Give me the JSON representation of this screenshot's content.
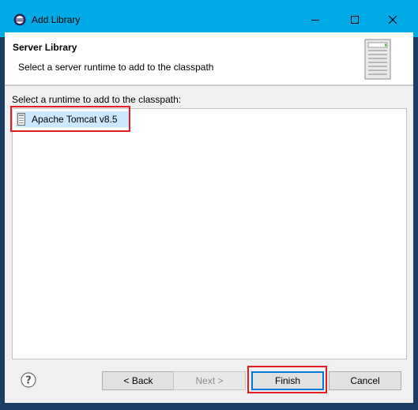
{
  "window": {
    "title": "Add Library",
    "controls": {
      "minimize": "minimize-icon",
      "maximize": "maximize-icon",
      "close": "close-icon"
    }
  },
  "header": {
    "heading": "Server Library",
    "description": "Select a server runtime to add to the classpath",
    "image_icon": "server-icon"
  },
  "body": {
    "prompt": "Select a runtime to add to the classpath:",
    "runtimes": [
      {
        "label": "Apache Tomcat v8.5",
        "icon": "server-runtime-icon",
        "selected": true
      }
    ]
  },
  "footer": {
    "help_icon": "help-icon",
    "back_label": "< Back",
    "next_label": "Next >",
    "finish_label": "Finish",
    "cancel_label": "Cancel"
  },
  "colors": {
    "titlebar": "#00aae6",
    "frame": "#1b3d64",
    "selection": "#cce8ff",
    "highlight": "#e31b23",
    "default_button_border": "#0078d7"
  }
}
